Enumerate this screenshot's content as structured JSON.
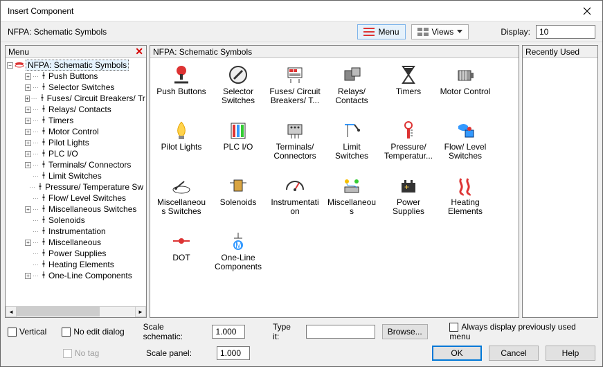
{
  "window": {
    "title": "Insert Component"
  },
  "toolbar": {
    "breadcrumb": "NFPA: Schematic Symbols",
    "menu_btn": "Menu",
    "views_btn": "Views",
    "display_label": "Display:",
    "display_value": "10"
  },
  "tree_panel": {
    "header": "Menu"
  },
  "tree": {
    "root": "NFPA: Schematic Symbols",
    "items": [
      {
        "label": "Push Buttons",
        "exp": "+",
        "conn": true
      },
      {
        "label": "Selector Switches",
        "exp": "+",
        "conn": true
      },
      {
        "label": "Fuses/ Circuit Breakers/ Tr",
        "exp": "+",
        "conn": true
      },
      {
        "label": "Relays/ Contacts",
        "exp": "+",
        "conn": true
      },
      {
        "label": "Timers",
        "exp": "+",
        "conn": true
      },
      {
        "label": "Motor Control",
        "exp": "+",
        "conn": true
      },
      {
        "label": "Pilot Lights",
        "exp": "+",
        "conn": true
      },
      {
        "label": "PLC I/O",
        "exp": "+",
        "conn": true
      },
      {
        "label": "Terminals/ Connectors",
        "exp": "+",
        "conn": true
      },
      {
        "label": "Limit Switches",
        "exp": "",
        "conn": true
      },
      {
        "label": "Pressure/ Temperature Sw",
        "exp": "",
        "conn": true
      },
      {
        "label": "Flow/ Level Switches",
        "exp": "",
        "conn": true
      },
      {
        "label": "Miscellaneous Switches",
        "exp": "+",
        "conn": true
      },
      {
        "label": "Solenoids",
        "exp": "",
        "conn": true
      },
      {
        "label": "Instrumentation",
        "exp": "",
        "conn": true
      },
      {
        "label": "Miscellaneous",
        "exp": "+",
        "conn": true
      },
      {
        "label": "Power Supplies",
        "exp": "",
        "conn": true
      },
      {
        "label": "Heating Elements",
        "exp": "",
        "conn": true
      },
      {
        "label": "One-Line Components",
        "exp": "+",
        "conn": true
      }
    ]
  },
  "grid_panel": {
    "header": "NFPA: Schematic Symbols"
  },
  "grid": [
    {
      "label": "Push Buttons",
      "icon": "push-button"
    },
    {
      "label": "Selector Switches",
      "icon": "selector"
    },
    {
      "label": "Fuses/ Circuit Breakers/ T...",
      "icon": "fuse"
    },
    {
      "label": "Relays/ Contacts",
      "icon": "relay"
    },
    {
      "label": "Timers",
      "icon": "timer"
    },
    {
      "label": "Motor Control",
      "icon": "motor"
    },
    {
      "label": "Pilot Lights",
      "icon": "pilot"
    },
    {
      "label": "PLC I/O",
      "icon": "plc"
    },
    {
      "label": "Terminals/ Connectors",
      "icon": "terminals"
    },
    {
      "label": "Limit Switches",
      "icon": "limit"
    },
    {
      "label": "Pressure/ Temperatur...",
      "icon": "pressure"
    },
    {
      "label": "Flow/ Level Switches",
      "icon": "flow"
    },
    {
      "label": "Miscellaneous Switches",
      "icon": "miscsw"
    },
    {
      "label": "Solenoids",
      "icon": "solenoid"
    },
    {
      "label": "Instrumentation",
      "icon": "instr"
    },
    {
      "label": "Miscellaneous",
      "icon": "misc"
    },
    {
      "label": "Power Supplies",
      "icon": "power"
    },
    {
      "label": "Heating Elements",
      "icon": "heat"
    },
    {
      "label": "DOT",
      "icon": "dot"
    },
    {
      "label": "One-Line Components",
      "icon": "oneline"
    }
  ],
  "right_panel": {
    "header": "Recently Used"
  },
  "footer": {
    "vertical": "Vertical",
    "no_edit": "No edit dialog",
    "no_tag": "No tag",
    "scale_schematic_label": "Scale schematic:",
    "scale_schematic_value": "1.000",
    "scale_panel_label": "Scale panel:",
    "scale_panel_value": "1.000",
    "type_it_label": "Type it:",
    "type_it_value": "",
    "browse": "Browse...",
    "always": "Always display previously used menu",
    "ok": "OK",
    "cancel": "Cancel",
    "help": "Help"
  }
}
